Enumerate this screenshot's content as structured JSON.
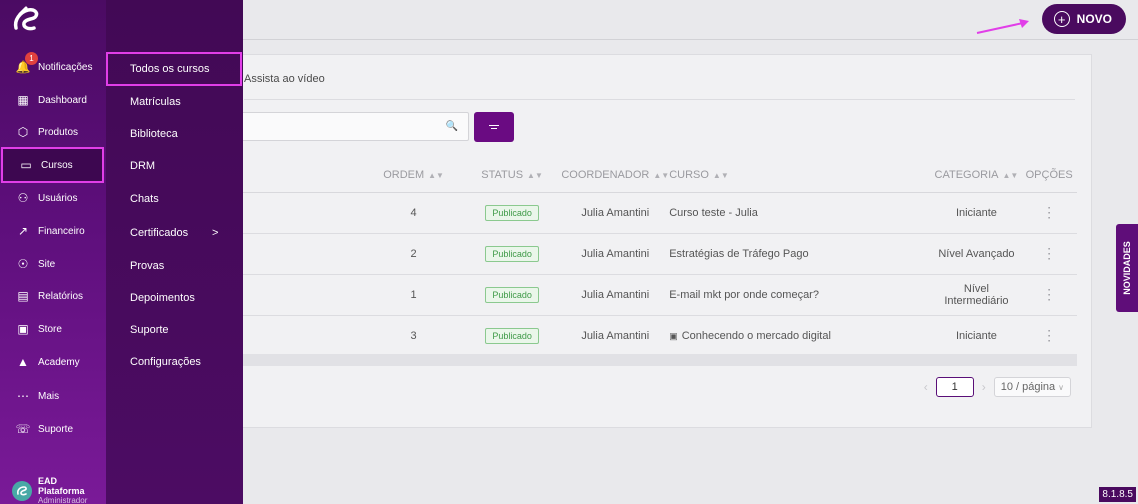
{
  "header": {
    "new_button_label": "NOVO"
  },
  "sidebar": {
    "notification_count": "1",
    "items": [
      {
        "label": "Notificações",
        "icon": "bell-icon"
      },
      {
        "label": "Dashboard",
        "icon": "grid-icon"
      },
      {
        "label": "Produtos",
        "icon": "cube-icon"
      },
      {
        "label": "Cursos",
        "icon": "book-icon"
      },
      {
        "label": "Usuários",
        "icon": "users-icon"
      },
      {
        "label": "Financeiro",
        "icon": "trend-icon"
      },
      {
        "label": "Site",
        "icon": "globe-icon"
      },
      {
        "label": "Relatórios",
        "icon": "report-icon"
      },
      {
        "label": "Store",
        "icon": "store-icon"
      },
      {
        "label": "Academy",
        "icon": "graduation-cap-icon"
      },
      {
        "label": "Mais",
        "icon": "more-dots-icon"
      },
      {
        "label": "Suporte",
        "icon": "whatsapp-icon"
      }
    ],
    "user": {
      "name": "EAD Plataforma",
      "role": "Administrador"
    }
  },
  "submenu": {
    "items": [
      "Todos os cursos",
      "Matrículas",
      "Biblioteca",
      "DRM",
      "Chats",
      "Certificados",
      "Provas",
      "Depoimentos",
      "Suporte",
      "Configurações"
    ]
  },
  "content": {
    "watch_video_label": "Assista ao vídeo",
    "table": {
      "headers": {
        "ordem": "ORDEM",
        "status": "STATUS",
        "coordenador": "COORDENADOR",
        "curso": "CURSO",
        "categoria": "CATEGORIA",
        "opcoes": "OPÇÕES"
      },
      "rows": [
        {
          "ordem": "4",
          "status": "Publicado",
          "coordenador": "Julia Amantini",
          "curso": "Curso teste - Julia",
          "categoria": "Iniciante"
        },
        {
          "ordem": "2",
          "status": "Publicado",
          "coordenador": "Julia Amantini",
          "curso": "Estratégias de Tráfego Pago",
          "categoria": "Nível Avançado"
        },
        {
          "ordem": "1",
          "status": "Publicado",
          "coordenador": "Julia Amantini",
          "curso": "E-mail mkt por onde começar?",
          "categoria": "Nível Intermediário"
        },
        {
          "ordem": "3",
          "status": "Publicado",
          "coordenador": "Julia Amantini",
          "curso": "Conhecendo o mercado digital",
          "categoria": "Iniciante"
        }
      ]
    },
    "pagination": {
      "current_page": "1",
      "page_size": "10 / página"
    }
  },
  "novidades_label": "NOVIDADES",
  "version": "8.1.8.5",
  "colors": {
    "brand": "#5f0d79",
    "highlight": "#e13ee8",
    "status_green": "#3f9a48"
  }
}
